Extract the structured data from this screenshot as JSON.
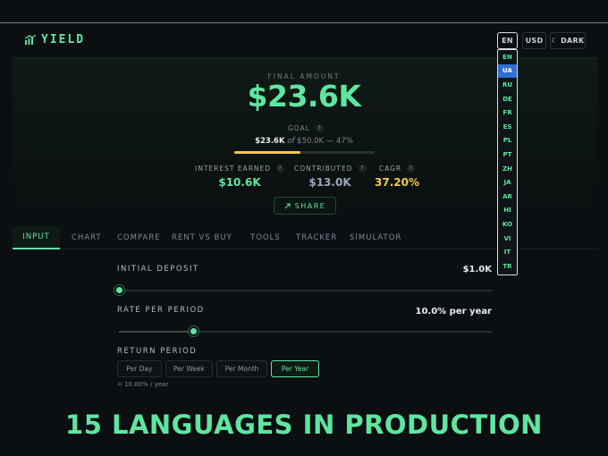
{
  "header": {
    "app_name": "YIELD",
    "language_button": "EN",
    "currency_button": "USD",
    "theme_button": "☾ DARK"
  },
  "hero": {
    "final_amount_label": "FINAL AMOUNT",
    "final_amount": "$23.6K",
    "goal_label": "GOAL",
    "goal_current": "$23.6K",
    "goal_of": "of",
    "goal_target": "$50.0K",
    "goal_percent": "— 47%",
    "goal_progress": 0.47,
    "stats": [
      {
        "label": "INTEREST EARNED",
        "value": "$10.6K"
      },
      {
        "label": "CONTRIBUTED",
        "value": "$13.0K"
      },
      {
        "label": "CAGR",
        "value": "37.20%"
      }
    ],
    "share_label": "SHARE",
    "help_glyph": "?"
  },
  "tabs": [
    "INPUT",
    "CHART",
    "COMPARE",
    "RENT VS BUY",
    "TOOLS",
    "TRACKER",
    "SIMULATOR"
  ],
  "inputs": {
    "initial_deposit_label": "INITIAL DEPOSIT",
    "initial_deposit_value": "$1.0K",
    "initial_deposit_slider": 0.0,
    "rate_label": "RATE PER PERIOD",
    "rate_value": "10.0% per year",
    "rate_slider": 0.2,
    "return_period_label": "RETURN PERIOD",
    "periods": [
      "Per Day",
      "Per Week",
      "Per Month",
      "Per Year"
    ],
    "selected_period": "Per Year",
    "rate_note": "= 10.00% / year"
  },
  "language_dropdown": {
    "options": [
      "EN",
      "UA",
      "RU",
      "DE",
      "FR",
      "ES",
      "PL",
      "PT",
      "ZH",
      "JA",
      "AR",
      "HI",
      "KO",
      "VI",
      "IT",
      "TR"
    ],
    "highlighted": "UA"
  },
  "banner": "15 LANGUAGES IN PRODUCTION",
  "colors": {
    "accent": "#5ee6a0",
    "gold": "#f2c94c",
    "highlight": "#2f6fd6",
    "background": "#0b0f12"
  }
}
